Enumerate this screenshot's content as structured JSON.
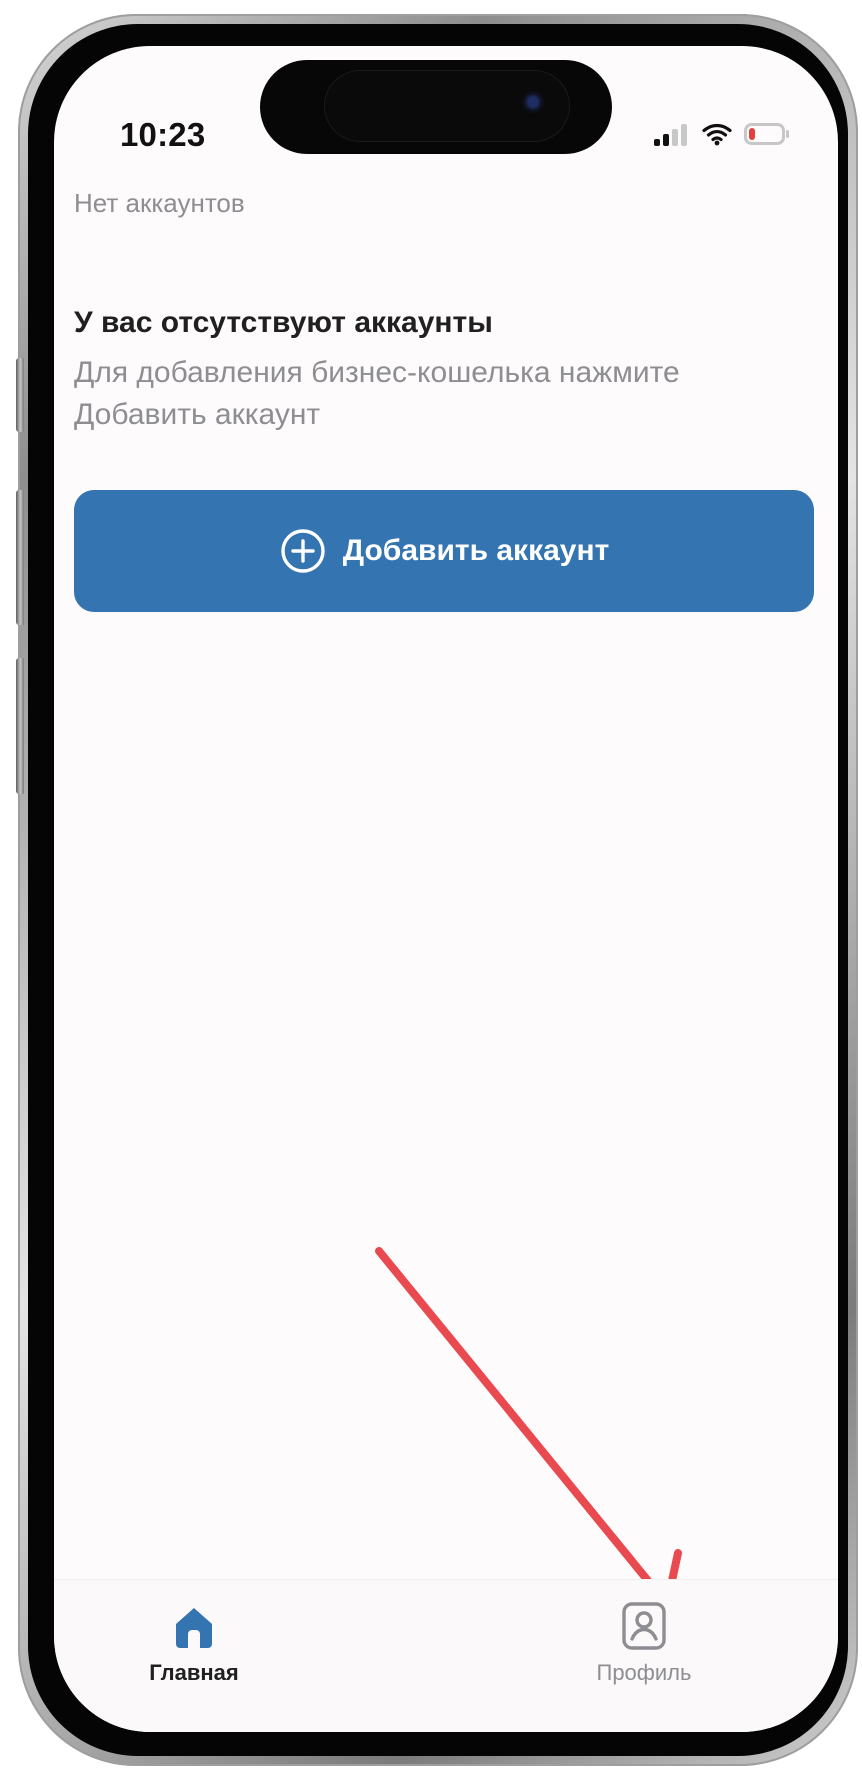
{
  "status_bar": {
    "time": "10:23",
    "icons": {
      "signal": "signal-icon",
      "wifi": "wifi-icon",
      "battery": "battery-icon"
    }
  },
  "page": {
    "section_label": "Нет аккаунтов",
    "empty_state": {
      "title": "У вас отсутствуют аккаунты",
      "description": "Для добавления бизнес-кошелька нажмите Добавить аккаунт"
    },
    "primary_action": {
      "label": "Добавить аккаунт",
      "icon": "plus-circle-icon",
      "color": "#3474B0"
    }
  },
  "tab_bar": {
    "items": [
      {
        "label": "Главная",
        "icon": "home-icon",
        "active": true,
        "color": "#3474B0"
      },
      {
        "label": "Профиль",
        "icon": "profile-icon",
        "active": false,
        "color": "#8D8D92"
      }
    ]
  },
  "annotation": {
    "icon": "red-arrow-icon",
    "color": "#E84A4F"
  }
}
